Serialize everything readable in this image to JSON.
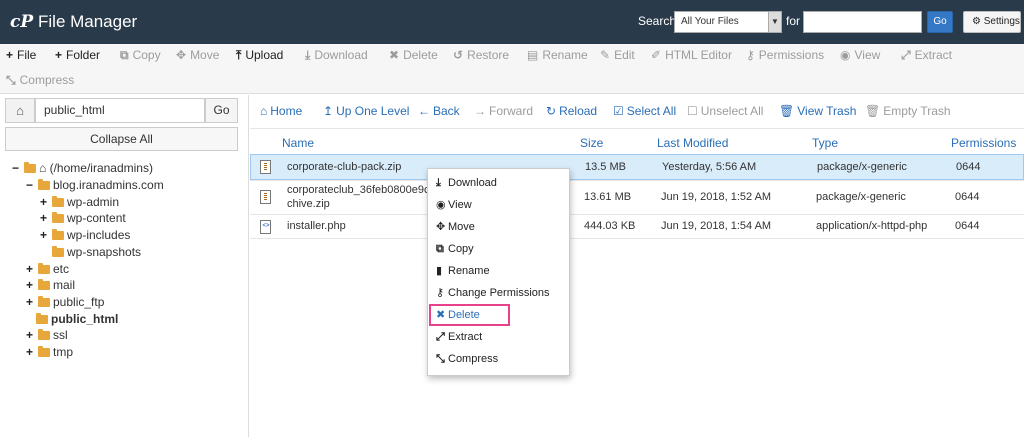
{
  "header": {
    "logo": "cP",
    "title": "File Manager",
    "search_label": "Search",
    "search_scope": "All Your Files",
    "for_label": "for",
    "search_value": "",
    "go_label": "Go",
    "settings_label": "Settings"
  },
  "toolbar": {
    "file": "File",
    "folder": "Folder",
    "copy": "Copy",
    "move": "Move",
    "upload": "Upload",
    "download": "Download",
    "delete": "Delete",
    "restore": "Restore",
    "rename": "Rename",
    "edit": "Edit",
    "html_editor": "HTML Editor",
    "permissions": "Permissions",
    "view": "View",
    "extract": "Extract",
    "compress": "Compress"
  },
  "left": {
    "path_value": "public_html",
    "go_label": "Go",
    "collapse_label": "Collapse All",
    "tree": {
      "root": "(/home/iranadmins)",
      "blog": "blog.iranadmins.com",
      "wp_admin": "wp-admin",
      "wp_content": "wp-content",
      "wp_includes": "wp-includes",
      "wp_snapshots": "wp-snapshots",
      "etc": "etc",
      "mail": "mail",
      "public_ftp": "public_ftp",
      "public_html": "public_html",
      "ssl": "ssl",
      "tmp": "tmp"
    }
  },
  "nav": {
    "home": "Home",
    "up": "Up One Level",
    "back": "Back",
    "forward": "Forward",
    "reload": "Reload",
    "select_all": "Select All",
    "unselect_all": "Unselect All",
    "view_trash": "View Trash",
    "empty_trash": "Empty Trash"
  },
  "table": {
    "headers": {
      "name": "Name",
      "size": "Size",
      "modified": "Last Modified",
      "type": "Type",
      "perms": "Permissions"
    },
    "rows": [
      {
        "name": "corporate-club-pack.zip",
        "size": "13.5 MB",
        "modified": "Yesterday, 5:56 AM",
        "type": "package/x-generic",
        "perms": "0644"
      },
      {
        "name_line1": "corporateclub_36feb0800e9c",
        "name_line2": "chive.zip",
        "size": "13.61 MB",
        "modified": "Jun 19, 2018, 1:52 AM",
        "type": "package/x-generic",
        "perms": "0644"
      },
      {
        "name": "installer.php",
        "size": "444.03 KB",
        "modified": "Jun 19, 2018, 1:54 AM",
        "type": "application/x-httpd-php",
        "perms": "0644"
      }
    ]
  },
  "context_menu": {
    "download": "Download",
    "view": "View",
    "move": "Move",
    "copy": "Copy",
    "rename": "Rename",
    "change_permissions": "Change Permissions",
    "delete": "Delete",
    "extract": "Extract",
    "compress": "Compress"
  },
  "colors": {
    "header_bg": "#293a4a",
    "link": "#2a6eb6",
    "highlight_border": "#e8428a",
    "selected_row": "#d9ecfa"
  }
}
